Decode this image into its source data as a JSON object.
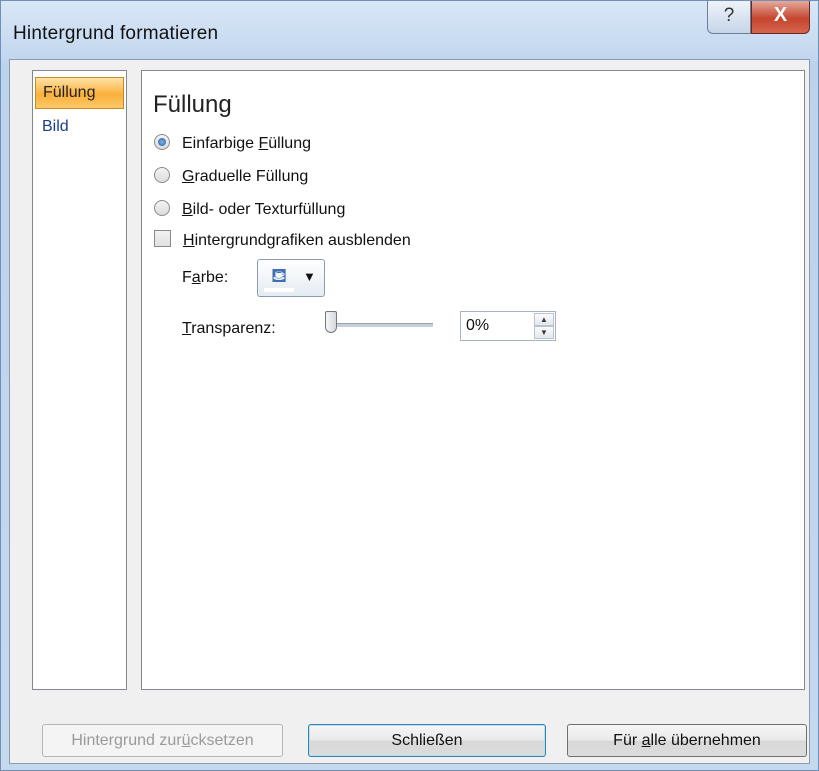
{
  "window": {
    "title": "Hintergrund formatieren",
    "help_label": "?",
    "close_label": "X"
  },
  "nav": {
    "items": [
      {
        "label": "Füllung",
        "selected": true
      },
      {
        "label": "Bild",
        "selected": false
      }
    ]
  },
  "panel": {
    "heading": "Füllung",
    "options": [
      {
        "type": "radio",
        "label": "Einfarbige Füllung",
        "checked": true
      },
      {
        "type": "radio",
        "label": "Graduelle Füllung",
        "checked": false
      },
      {
        "type": "radio",
        "label": "Bild- oder Texturfüllung",
        "checked": false
      },
      {
        "type": "checkbox",
        "label": "Hintergrundgrafiken ausblenden",
        "checked": false
      }
    ],
    "color_label": "Farbe:",
    "color_icon": "paint-bucket-icon",
    "transparency_label": "Transparenz:",
    "transparency_value": "0%",
    "transparency_level": 0
  },
  "buttons": {
    "reset": "Hintergrund zurücksetzen",
    "close": "Schließen",
    "apply_all": "Für alle übernehmen"
  },
  "colors": {
    "accent": "#fbb03c",
    "title_bar": "#c1d6ee",
    "close_button": "#c6452f"
  }
}
